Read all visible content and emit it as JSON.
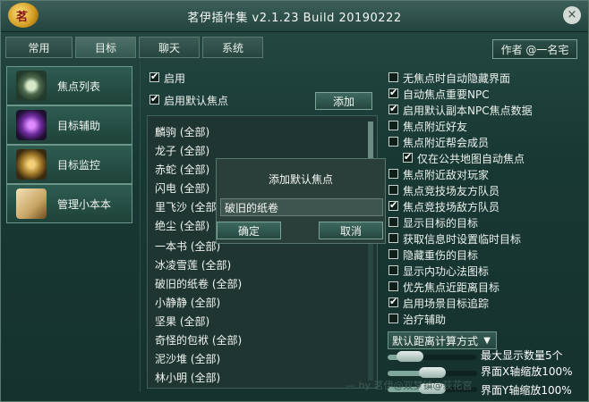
{
  "window": {
    "title": "茗伊插件集 v2.1.23 Build 20190222",
    "logo_char": "茗",
    "close_glyph": "×"
  },
  "tabs": [
    {
      "label": "常用"
    },
    {
      "label": "目标"
    },
    {
      "label": "聊天"
    },
    {
      "label": "系统"
    }
  ],
  "author_button": "作者 @一名宅",
  "sidebar": {
    "items": [
      {
        "label": "焦点列表",
        "icon": "eye-icon"
      },
      {
        "label": "目标辅助",
        "icon": "rune-icon"
      },
      {
        "label": "目标监控",
        "icon": "shield-icon"
      },
      {
        "label": "管理小本本",
        "icon": "book-icon"
      }
    ]
  },
  "focus": {
    "enable_label": "启用",
    "enable_checked": true,
    "default_focus_label": "启用默认焦点",
    "default_focus_checked": true,
    "add_button": "添加",
    "list": [
      "麟驹 (全部)",
      "龙子 (全部)",
      "赤蛇 (全部)",
      "闪电 (全部)",
      "里飞沙 (全部)",
      "绝尘 (全部)",
      "一本书 (全部)",
      "冰凌雪莲 (全部)",
      "破旧的纸卷 (全部)",
      "小静静 (全部)",
      "坚果 (全部)",
      "奇怪的包袱 (全部)",
      "泥沙堆 (全部)",
      "林小明 (全部)"
    ]
  },
  "dialog": {
    "title": "添加默认焦点",
    "input_value": "破旧的纸卷",
    "ok": "确定",
    "cancel": "取消"
  },
  "options": [
    {
      "label": "无焦点时自动隐藏界面",
      "checked": false
    },
    {
      "label": "自动焦点重要NPC",
      "checked": true
    },
    {
      "label": "启用默认副本NPC焦点数据",
      "checked": true
    },
    {
      "label": "焦点附近好友",
      "checked": false
    },
    {
      "label": "焦点附近帮会成员",
      "checked": false
    },
    {
      "label": "仅在公共地图自动焦点",
      "checked": true
    },
    {
      "label": "焦点附近敌对玩家",
      "checked": false
    },
    {
      "label": "焦点竞技场友方队员",
      "checked": false
    },
    {
      "label": "焦点竞技场敌方队员",
      "checked": true
    },
    {
      "label": "显示目标的目标",
      "checked": false
    },
    {
      "label": "获取信息时设置临时目标",
      "checked": false
    },
    {
      "label": "隐藏重伤的目标",
      "checked": false
    },
    {
      "label": "显示内功心法图标",
      "checked": false
    },
    {
      "label": "优先焦点近距离目标",
      "checked": false
    },
    {
      "label": "启用场景目标追踪",
      "checked": true
    },
    {
      "label": "治疗辅助",
      "checked": false
    }
  ],
  "distance_combo": "默认距离计算方式",
  "stats": {
    "max_display": "最大显示数量5个",
    "scale_x": "界面X轴缩放100%",
    "scale_y": "界面Y轴缩放100%"
  },
  "sliders": {
    "max_display_level": 0.25,
    "scale_x_level": 0.5,
    "scale_y_level": 0.5
  },
  "footer": "— by 茗伊@双梦镇@荻花宫"
}
